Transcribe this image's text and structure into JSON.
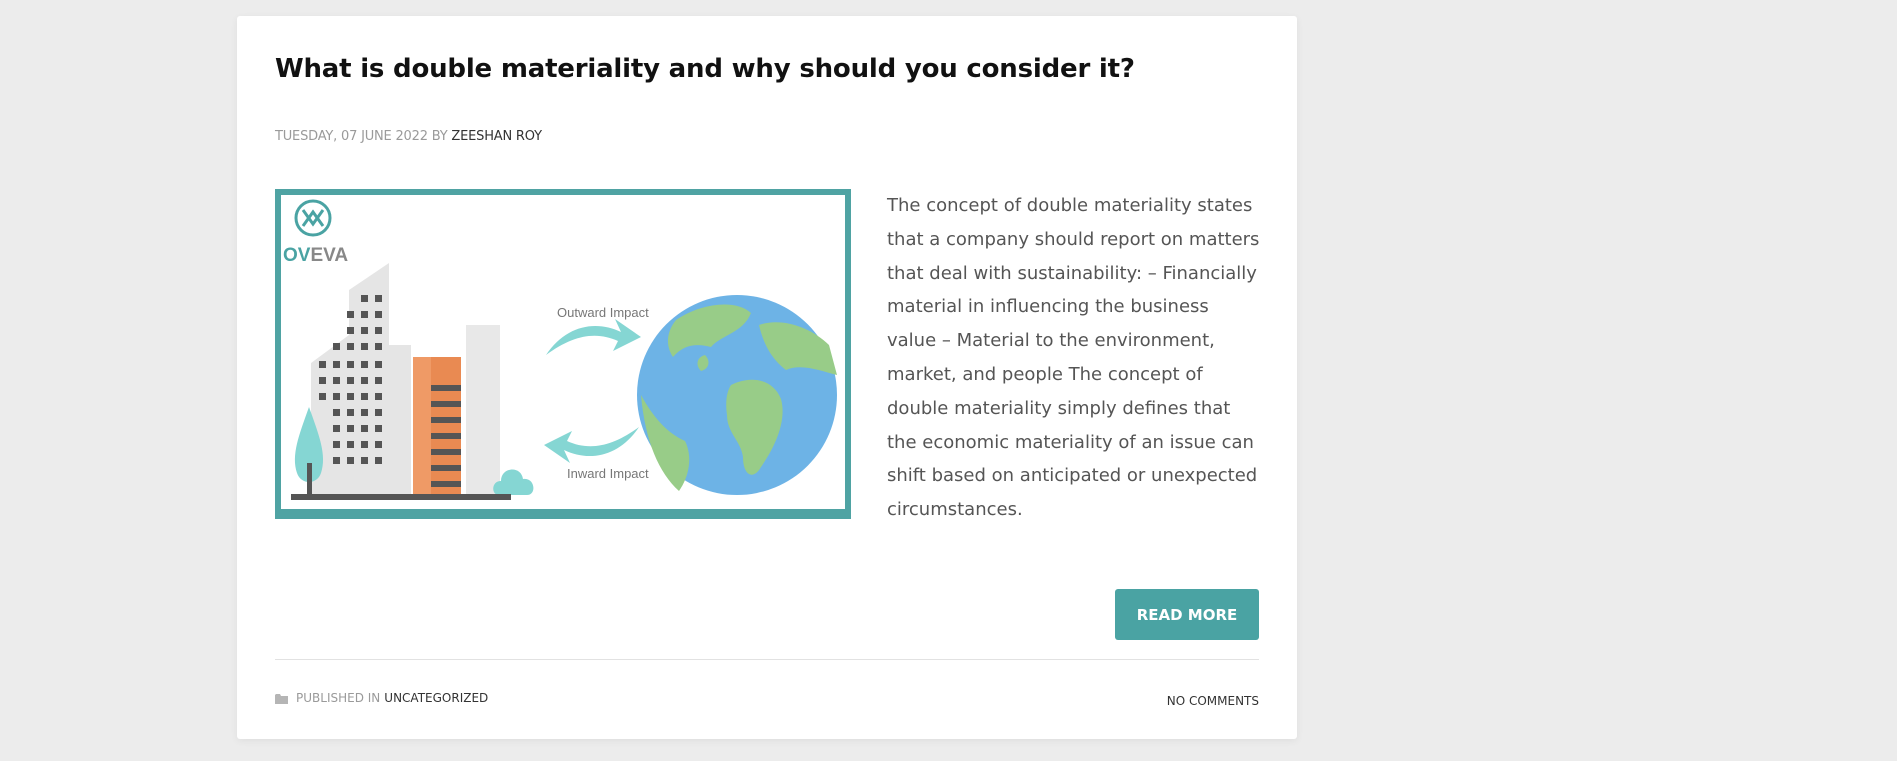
{
  "post": {
    "title": "What is double materiality and why should you consider it?",
    "date": "TUESDAY, 07 JUNE 2022",
    "by_label": "BY",
    "author": "ZEESHAN ROY",
    "image": {
      "logo_text_ov": "OV",
      "logo_text_eva": "EVA",
      "outward_label": "Outward Impact",
      "inward_label": "Inward Impact"
    },
    "excerpt": "The concept of double materiality states that a company should report on matters that deal with sustainability: – Financially material in influencing the business value – Material to the environment, market, and people The concept of double materiality simply defines that the economic materiality of an issue can shift based on anticipated or unexpected circumstances.",
    "read_more_label": "READ MORE",
    "published_in_label": "PUBLISHED IN",
    "category": "UNCATEGORIZED",
    "comments_label": "NO COMMENTS"
  },
  "colors": {
    "accent": "#4aa3a3",
    "page_background": "#ececec",
    "building_orange": "#e98a52",
    "earth_blue": "#6db3e6",
    "earth_green": "#98cc88"
  },
  "icons": {
    "folder": "folder-icon",
    "logo": "oveva-logo-icon"
  }
}
